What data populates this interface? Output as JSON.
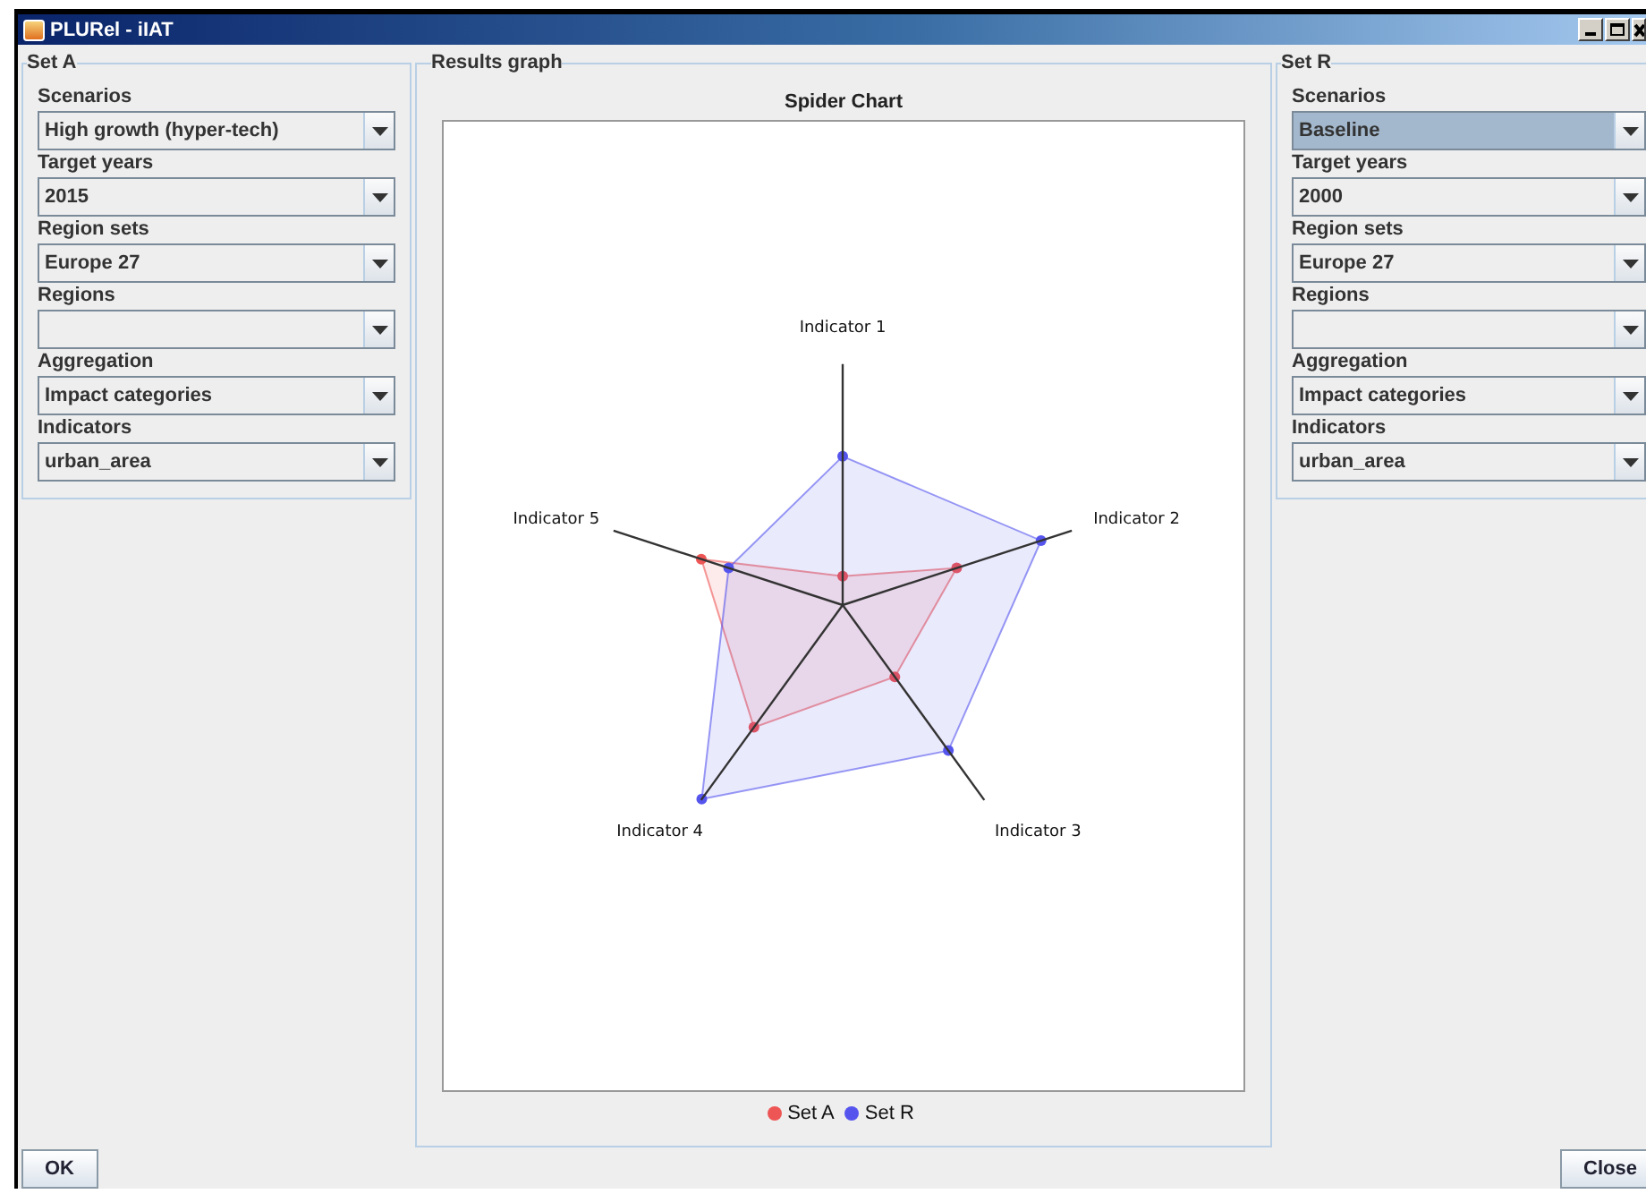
{
  "window": {
    "title": "PLURel - iIAT"
  },
  "set_a": {
    "title": "Set A",
    "fields": [
      {
        "label": "Scenarios",
        "value": "High growth (hyper-tech)",
        "focused": false
      },
      {
        "label": "Target years",
        "value": "2015",
        "focused": false
      },
      {
        "label": "Region sets",
        "value": "Europe 27",
        "focused": false
      },
      {
        "label": "Regions",
        "focused": false
      },
      {
        "label": "Aggregation",
        "value": "Impact categories",
        "focused": false
      },
      {
        "label": "Indicators",
        "value": "urban_area",
        "focused": false
      }
    ]
  },
  "results": {
    "title": "Results graph",
    "chart": {
      "title": "Spider Chart",
      "axes": [
        "Indicator 1",
        "Indicator 2",
        "Indicator 3",
        "Indicator 4",
        "Indicator 5"
      ],
      "series": [
        {
          "name": "Set A",
          "color": "#ee5555"
        },
        {
          "name": "Set R",
          "color": "#5555ee"
        }
      ]
    }
  },
  "set_r": {
    "title": "Set R",
    "fields": [
      {
        "label": "Scenarios",
        "value": "Baseline",
        "focused": true
      },
      {
        "label": "Target years",
        "value": "2000",
        "focused": false
      },
      {
        "label": "Region sets",
        "value": "Europe 27",
        "focused": false
      },
      {
        "label": "Regions",
        "focused": false
      },
      {
        "label": "Aggregation",
        "value": "Impact categories",
        "focused": false
      },
      {
        "label": "Indicators",
        "value": "urban_area",
        "focused": false
      }
    ]
  },
  "buttons": [
    {
      "label": "OK"
    },
    {
      "label": "Close"
    }
  ]
}
